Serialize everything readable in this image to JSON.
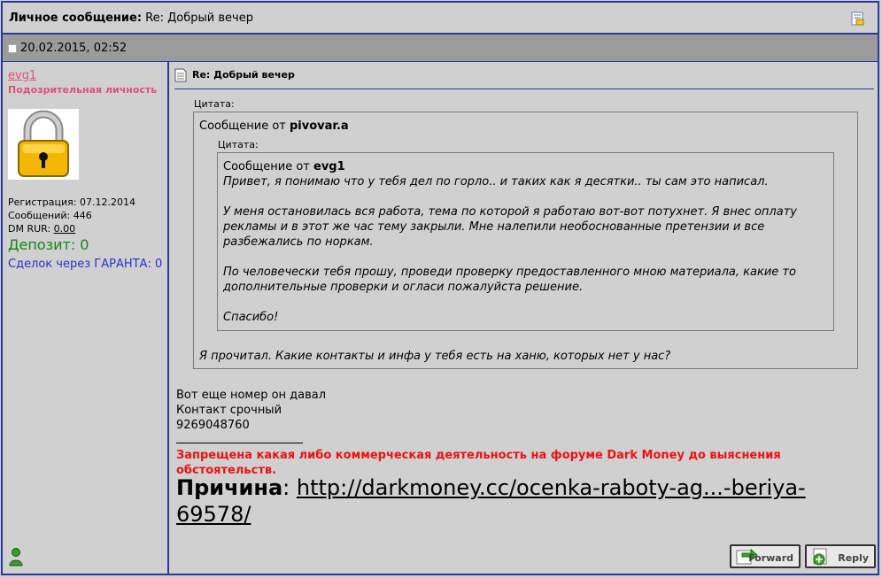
{
  "header": {
    "title_label": "Личное сообщение:",
    "title_subject": "Re: Добрый вечер",
    "print_icon": "print-preview-icon"
  },
  "post": {
    "date": "20.02.2015, 02:52",
    "title": "Re: Добрый вечер"
  },
  "user": {
    "name": "evg1",
    "rank": "Подозрительная личность",
    "avatar_icon": "padlock-icon",
    "registration_label": "Регистрация:",
    "registration": "07.12.2014",
    "messages_label": "Сообщений:",
    "messages": "446",
    "dm_label": "DM RUR:",
    "dm_value": "0.00",
    "deposit": "Депозит: 0",
    "garant_deals": "Сделок через ГАРАНТА: 0",
    "online_icon": "user-online-icon"
  },
  "quotes": {
    "outer_label": "Цитата:",
    "outer_from_prefix": "Сообщение от",
    "outer_author": "pivovar.a",
    "inner_label": "Цитата:",
    "inner_from_prefix": "Сообщение от",
    "inner_author": "evg1",
    "inner_lines": [
      "Привет, я понимаю что у тебя дел по горло.. и таких как я десятки.. ты сам это написал.",
      "У меня остановилась вся работа, тема по которой я работаю вот-вот потухнет. Я внес оплату",
      "рекламы и в этот же час тему закрыли. Мне налепили необоснованные претензии и все",
      "разбежались по норкам.",
      "По человечески тебя прошу, проведи проверку предоставленного мною материала, какие то",
      "дополнительные проверки и огласи пожалуйста решение.",
      "Спасибо!"
    ],
    "outer_reply": "Я прочитал. Какие контакты и инфа у тебя есть на ханю, которых нет у нас?"
  },
  "message": {
    "lines": [
      "Вот еще номер он давал",
      "Контакт срочный",
      "9269048760"
    ]
  },
  "signature": {
    "warning": "Запрещена какая либо коммерческая деятельность на форуме Dark Money до выяснения обстоятельств.",
    "reason_label": "Причина",
    "reason_sep": ":",
    "reason_link": "http://darkmoney.cc/ocenka-raboty-ag...-beriya-69578/"
  },
  "buttons": {
    "forward": "Forward",
    "reply": "Reply"
  },
  "colors": {
    "border": "#2a3a9a",
    "username": "#e0507a",
    "deposit": "#118811",
    "garant": "#2233cc",
    "warning": "#ee1111"
  }
}
